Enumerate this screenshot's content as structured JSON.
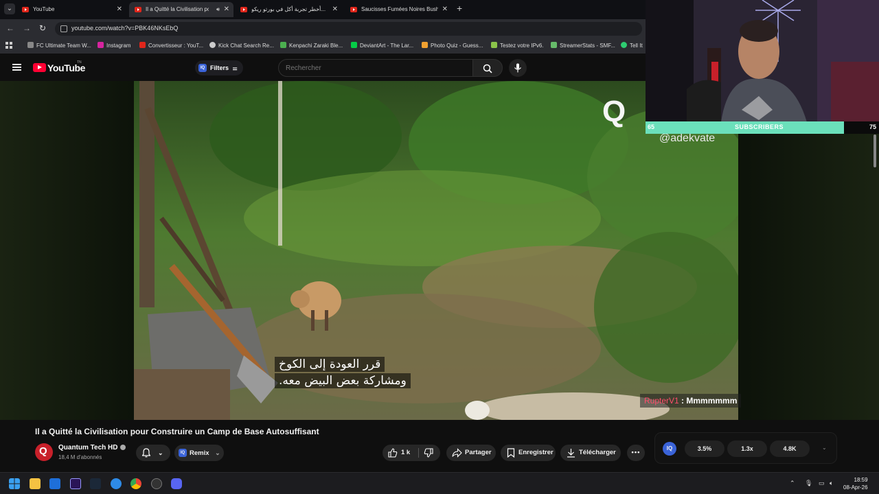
{
  "tabs": [
    {
      "title": "YouTube",
      "active": false
    },
    {
      "title": "Il a Quitté la Civilisation po",
      "active": true
    },
    {
      "title": "أخطر تجربة أكل في بورتو ريكو...",
      "active": false
    },
    {
      "title": "Saucisses Fumées Noires Bushi",
      "active": false
    }
  ],
  "address": {
    "url": "youtube.com/watch?v=PBK46NKsEbQ"
  },
  "bookmarks": [
    {
      "label": "FC Ultimate Team W...",
      "color": "#888888"
    },
    {
      "label": "Instagram",
      "color": "#d6249f"
    },
    {
      "label": "Convertisseur : YouT...",
      "color": "#e0261b"
    },
    {
      "label": "Kick Chat Search Re...",
      "color": "#cccccc"
    },
    {
      "label": "Kenpachi Zaraki Ble...",
      "color": "#4caf50"
    },
    {
      "label": "DeviantArt - The Lar...",
      "color": "#05cc47"
    },
    {
      "label": "Photo Quiz - Guess...",
      "color": "#f0a030"
    },
    {
      "label": "Testez votre IPv6.",
      "color": "#8bc34a"
    },
    {
      "label": "StreamerStats - SMF...",
      "color": "#66bb6a"
    },
    {
      "label": "Tell It",
      "color": "#2ecc71"
    }
  ],
  "header": {
    "logo_text": "YouTube",
    "logo_sup": "TN",
    "filters_label": "Filters",
    "filters_icon": "IQ",
    "search_placeholder": "Rechercher"
  },
  "video": {
    "brand_logo": "Q",
    "watermark": "@adekvate",
    "subtitle_line1": "قرر العودة إلى الكوخ",
    "subtitle_line2": "ومشاركة بعض البيض معه."
  },
  "overlay": {
    "sub_left": "65",
    "sub_label": "SUBSCRIBERS",
    "sub_right": "75",
    "sub_progress": 0.85,
    "chat_user": "RupterV1",
    "chat_sep": " : ",
    "chat_message": "Mmmmmmm"
  },
  "meta": {
    "title": "Il a Quitté la Civilisation pour Construire un Camp de Base Autosuffisant",
    "channel": "Quantum Tech HD",
    "subscribers": "18,4 M d'abonnés",
    "remix_label": "Remix",
    "remix_icon": "IQ",
    "likes": "1 k",
    "share_label": "Partager",
    "save_label": "Enregistrer",
    "download_label": "Télécharger",
    "more_label": "•••"
  },
  "stats": {
    "badge": "IQ",
    "values": [
      "3.5%",
      "1.3x",
      "4.8K"
    ]
  },
  "taskbar": {
    "time": "18:59",
    "date": "08-Apr-26"
  }
}
